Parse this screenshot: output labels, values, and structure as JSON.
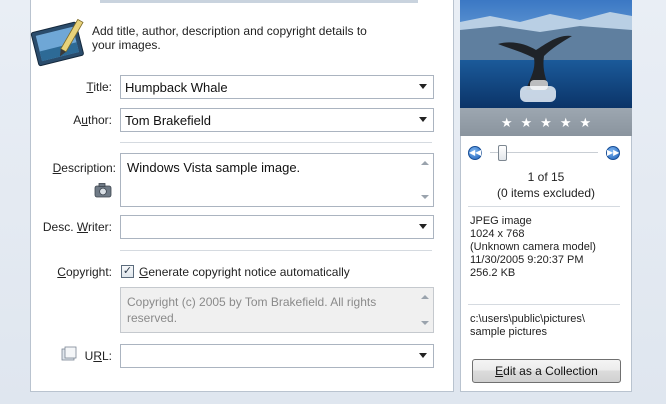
{
  "banner": {
    "text": "Add title, author, description and copyright details to your images."
  },
  "fields": {
    "title": {
      "label_pre": "",
      "label_mn": "T",
      "label_post": "itle:",
      "value": "Humpback Whale"
    },
    "author": {
      "label_pre": "A",
      "label_mn": "u",
      "label_post": "thor:",
      "value": "Tom Brakefield"
    },
    "description": {
      "label_pre": "",
      "label_mn": "D",
      "label_post": "escription:",
      "value": "Windows Vista sample image."
    },
    "desc_writer": {
      "label_pre": "Desc. ",
      "label_mn": "W",
      "label_post": "riter:",
      "value": ""
    },
    "copyright": {
      "label_pre": "",
      "label_mn": "C",
      "label_post": "opyright:",
      "checkbox_checked": true,
      "checkbox_label_pre": "",
      "checkbox_label_mn": "G",
      "checkbox_label_post": "enerate copyright notice automatically",
      "value": "Copyright (c) 2005 by Tom Brakefield. All rights reserved."
    },
    "url": {
      "label_pre": "U",
      "label_mn": "R",
      "label_post": "L:",
      "value": ""
    }
  },
  "preview": {
    "rating_stars": 5,
    "rating_value": 0,
    "counter": "1 of 15",
    "excluded": "(0 items excluded)",
    "slider_position": 0
  },
  "info": {
    "type": "JPEG image",
    "dimensions": "1024 x 768",
    "camera": "(Unknown camera model)",
    "date": "11/30/2005 9:20:37 PM",
    "size": "256.2 KB",
    "path_line1": "c:\\users\\public\\pictures\\",
    "path_line2": "sample pictures"
  },
  "buttons": {
    "edit_collection_mn": "E",
    "edit_collection_rest": "dit as a Collection"
  },
  "colors": {
    "nav_blue": "#1c5fb8",
    "sky": "#2f6fbf",
    "sea": "#0d3f7a"
  }
}
